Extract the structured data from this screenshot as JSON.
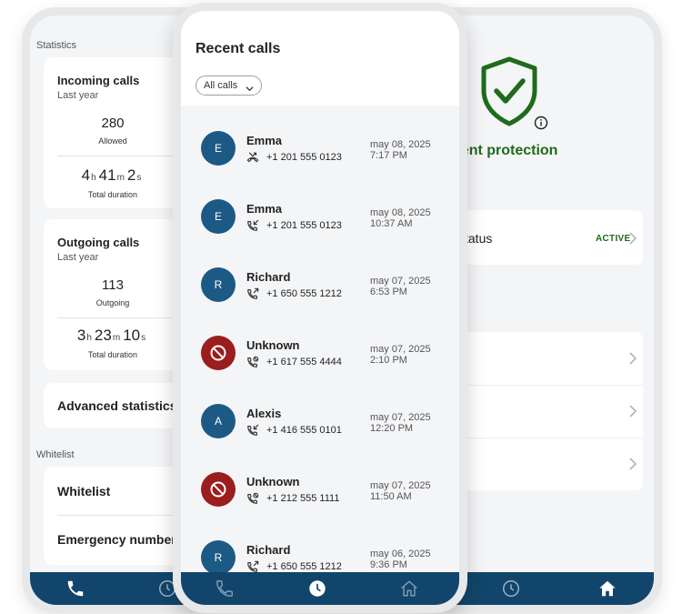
{
  "statistics_screen": {
    "section_label": "Statistics",
    "incoming": {
      "title": "Incoming calls",
      "period": "Last year",
      "count": "280",
      "count_caption": "Allowed",
      "duration": {
        "h": "4",
        "h_unit": "h",
        "m": "41",
        "m_unit": "m",
        "s": "2",
        "s_unit": "s"
      },
      "duration_caption": "Total duration"
    },
    "outgoing": {
      "title": "Outgoing calls",
      "period": "Last year",
      "count": "113",
      "count_caption": "Outgoing",
      "duration": {
        "h": "3",
        "h_unit": "h",
        "m": "23",
        "m_unit": "m",
        "s": "10",
        "s_unit": "s"
      },
      "duration_caption": "Total duration"
    },
    "advanced_label": "Advanced statistics",
    "whitelist_section_label": "Whitelist",
    "whitelist_item": "Whitelist",
    "emergency_item": "Emergency number"
  },
  "protection_screen": {
    "title": "ellent protection",
    "status_label": "tatus",
    "status_badge": "ACTIVE",
    "accent_color": "#1e6b1c"
  },
  "recent_calls": {
    "title": "Recent calls",
    "filter_label": "All calls",
    "calls": [
      {
        "name": "Emma",
        "initial": "E",
        "blocked": false,
        "type": "missed-call-icon",
        "number": "+1 201 555 0123",
        "date": "may 08, 2025",
        "time": "7:17 PM"
      },
      {
        "name": "Emma",
        "initial": "E",
        "blocked": false,
        "type": "incoming-call-icon",
        "number": "+1 201 555 0123",
        "date": "may 08, 2025",
        "time": "10:37 AM"
      },
      {
        "name": "Richard",
        "initial": "R",
        "blocked": false,
        "type": "outgoing-call-icon",
        "number": "+1 650 555 1212",
        "date": "may 07, 2025",
        "time": "6:53 PM"
      },
      {
        "name": "Unknown",
        "initial": "",
        "blocked": true,
        "type": "blocked-call-icon",
        "number": "+1 617 555 4444",
        "date": "may 07, 2025",
        "time": "2:10 PM"
      },
      {
        "name": "Alexis",
        "initial": "A",
        "blocked": false,
        "type": "incoming-call-icon",
        "number": "+1 416 555 0101",
        "date": "may 07, 2025",
        "time": "12:20 PM"
      },
      {
        "name": "Unknown",
        "initial": "",
        "blocked": true,
        "type": "blocked-call-icon",
        "number": "+1 212 555 1111",
        "date": "may 07, 2025",
        "time": "11:50 AM"
      },
      {
        "name": "Richard",
        "initial": "R",
        "blocked": false,
        "type": "outgoing-call-icon",
        "number": "+1 650 555 1212",
        "date": "may 06, 2025",
        "time": "9:36 PM"
      }
    ]
  },
  "colors": {
    "nav_bar": "#12456b",
    "avatar": "#1c5a85",
    "blocked_avatar": "#9b1d1d",
    "protection_green": "#1e6b1c"
  },
  "icons": {
    "nav": [
      "phone-icon",
      "clock-icon",
      "home-icon"
    ],
    "protection": "shield-check-icon",
    "info": "info-icon",
    "row_arrow": "chevron-right-icon"
  }
}
